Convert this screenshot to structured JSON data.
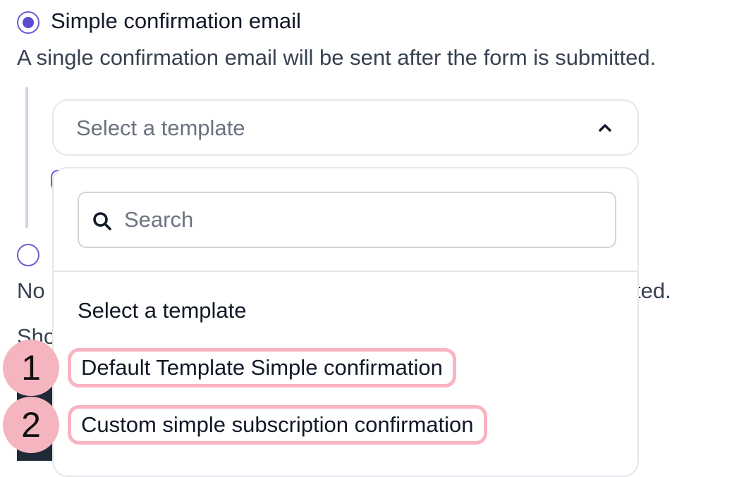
{
  "simple_option": {
    "label": "Simple confirmation email",
    "selected": true,
    "description": "A single confirmation email will be sent after the form is submitted."
  },
  "second_option": {
    "selected": false,
    "description_start": "No",
    "description_end": "ted."
  },
  "partial_label": "Sho",
  "template_select": {
    "placeholder": "Select a template",
    "expanded": true
  },
  "dropdown": {
    "search_placeholder": "Search",
    "options": [
      {
        "label": "Select a template"
      },
      {
        "label": "Default Template Simple confirmation",
        "marker": "1"
      },
      {
        "label": "Custom simple subscription confirmation",
        "marker": "2"
      }
    ]
  },
  "colors": {
    "accent": "#5b4bcf",
    "highlight": "#f8b4c0",
    "marker": "#f5b5bf"
  },
  "icons": {
    "search": "search-icon",
    "chevron": "chevron-up-icon"
  }
}
